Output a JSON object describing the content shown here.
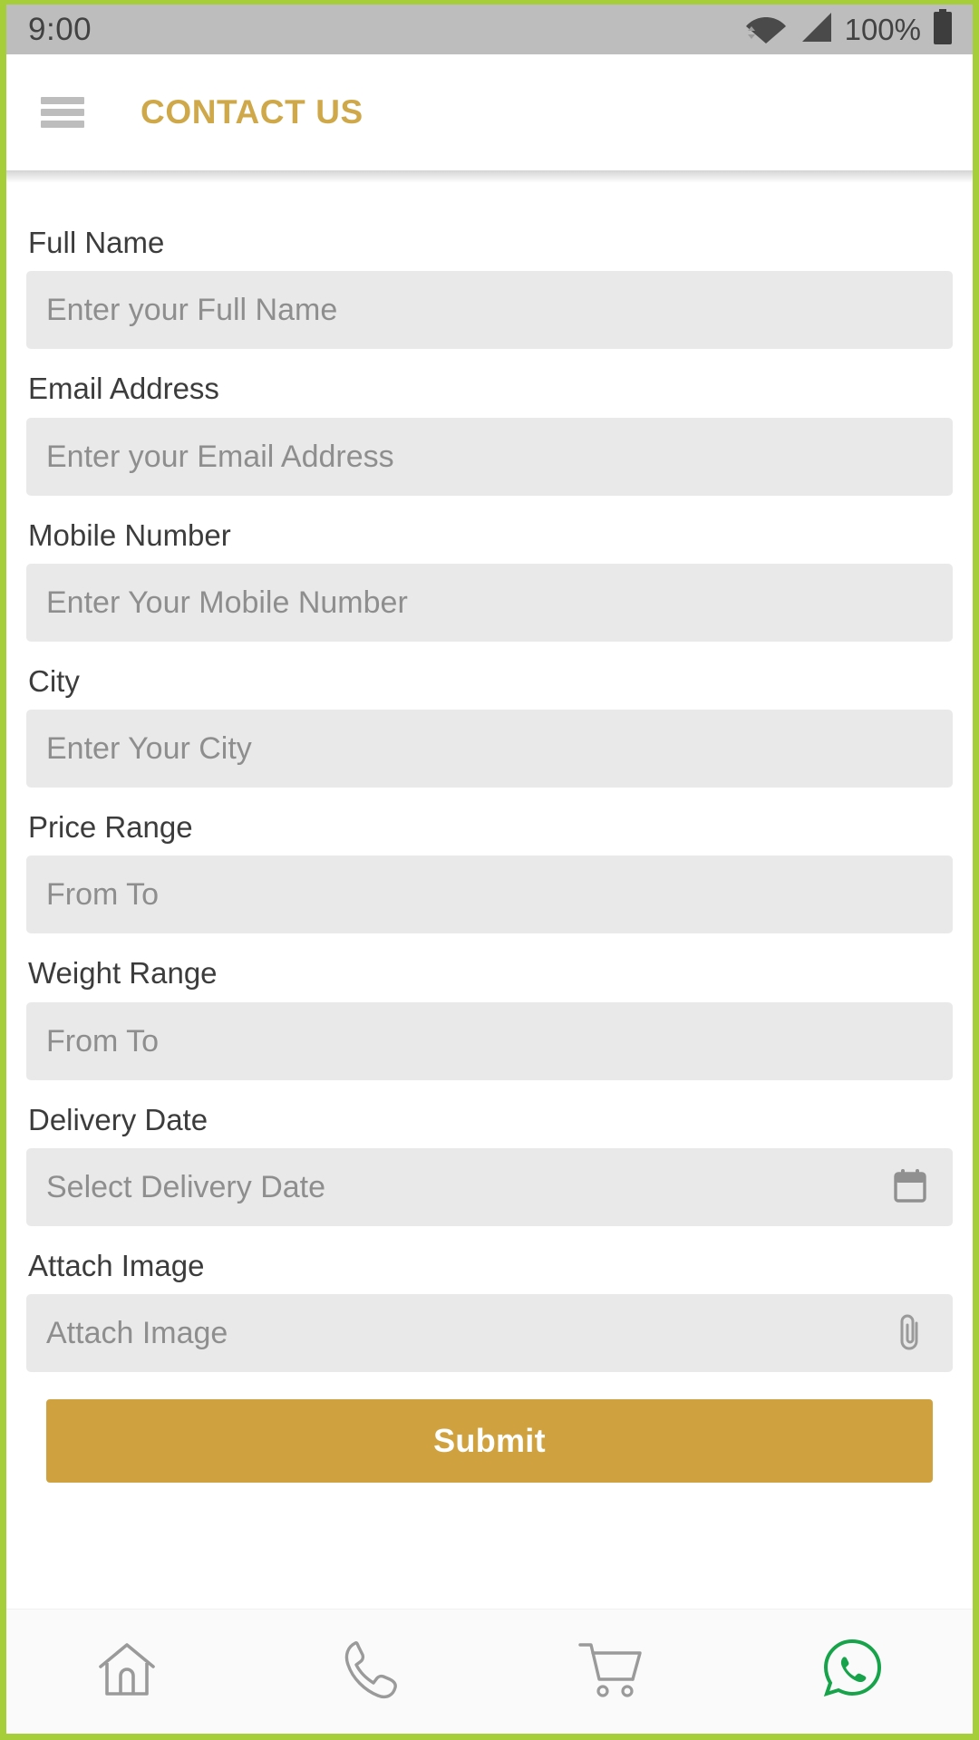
{
  "status_bar": {
    "time": "9:00",
    "battery_percent": "100%",
    "icons": [
      "wifi-icon",
      "cellular-signal-icon",
      "battery-icon"
    ]
  },
  "app_bar": {
    "menu_icon": "hamburger-menu-icon",
    "title": "CONTACT US",
    "title_color": "#cfa84a"
  },
  "theme": {
    "accent_gold": "#cfa23f",
    "frame_green": "#a6ce39",
    "whatsapp_green": "#17a34a",
    "input_background": "#e9e9e9",
    "placeholder_color": "#8e8e8e"
  },
  "form": {
    "fields": [
      {
        "label": "Full Name",
        "placeholder": "Enter your Full Name",
        "icon": null
      },
      {
        "label": "Email Address",
        "placeholder": "Enter your Email Address",
        "icon": null
      },
      {
        "label": "Mobile Number",
        "placeholder": "Enter Your Mobile Number",
        "icon": null
      },
      {
        "label": "City",
        "placeholder": "Enter Your City",
        "icon": null
      },
      {
        "label": "Price Range",
        "placeholder": "From To",
        "icon": null
      },
      {
        "label": "Weight Range",
        "placeholder": "From To",
        "icon": null
      },
      {
        "label": "Delivery Date",
        "placeholder": "Select Delivery Date",
        "icon": "calendar-icon"
      },
      {
        "label": "Attach Image",
        "placeholder": "Attach Image",
        "icon": "paperclip-icon"
      }
    ],
    "submit_label": "Submit"
  },
  "bottom_nav": {
    "items": [
      {
        "name": "home",
        "icon": "home-icon"
      },
      {
        "name": "call",
        "icon": "phone-icon"
      },
      {
        "name": "cart",
        "icon": "shopping-cart-icon"
      },
      {
        "name": "whatsapp",
        "icon": "whatsapp-icon"
      }
    ]
  }
}
